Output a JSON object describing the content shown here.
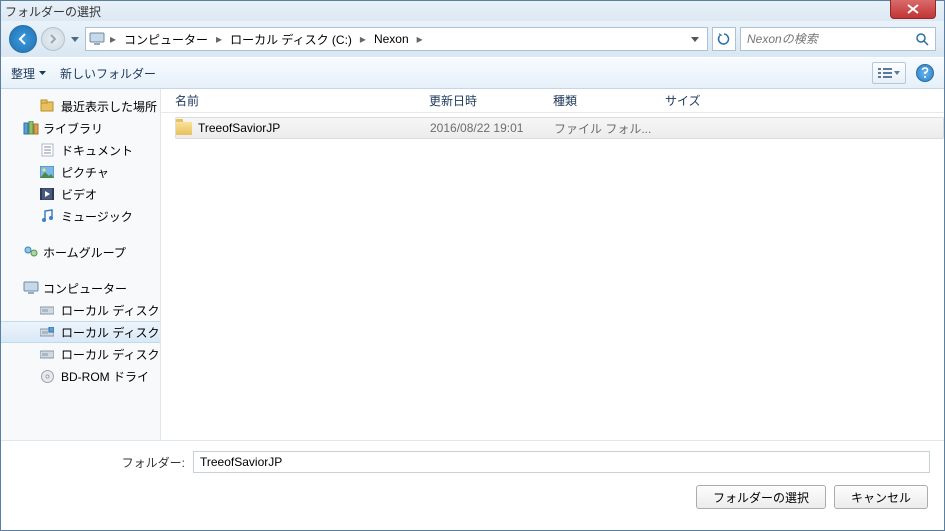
{
  "window": {
    "title": "フォルダーの選択"
  },
  "breadcrumb": {
    "items": [
      "コンピューター",
      "ローカル ディスク (C:)",
      "Nexon"
    ]
  },
  "search": {
    "placeholder": "Nexonの検索"
  },
  "toolbar": {
    "organize": "整理",
    "newfolder": "新しいフォルダー"
  },
  "sidebar": {
    "recent": {
      "label": "最近表示した場所"
    },
    "library": {
      "label": "ライブラリ",
      "items": [
        {
          "label": "ドキュメント"
        },
        {
          "label": "ピクチャ"
        },
        {
          "label": "ビデオ"
        },
        {
          "label": "ミュージック"
        }
      ]
    },
    "homegroup": {
      "label": "ホームグループ"
    },
    "computer": {
      "label": "コンピューター",
      "items": [
        {
          "label": "ローカル ディスク"
        },
        {
          "label": "ローカル ディスク",
          "selected": true
        },
        {
          "label": "ローカル ディスク"
        },
        {
          "label": "BD-ROM ドライ"
        }
      ]
    }
  },
  "columns": {
    "name": "名前",
    "date": "更新日時",
    "type": "種類",
    "size": "サイズ"
  },
  "rows": [
    {
      "name": "TreeofSaviorJP",
      "date": "2016/08/22 19:01",
      "type": "ファイル フォル..."
    }
  ],
  "bottom": {
    "folder_label": "フォルダー:",
    "folder_value": "TreeofSaviorJP",
    "select_btn": "フォルダーの選択",
    "cancel_btn": "キャンセル"
  }
}
